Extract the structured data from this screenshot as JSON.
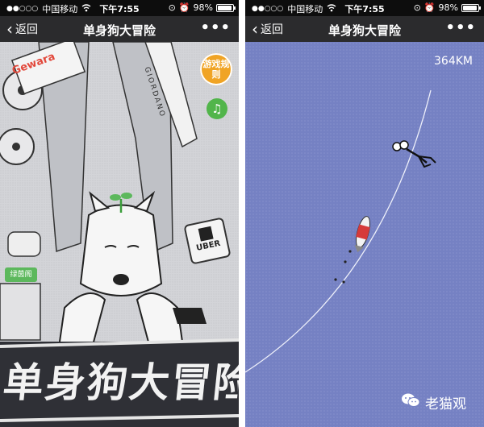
{
  "status_bar": {
    "signal": "●●○○○",
    "carrier": "中国移动",
    "time": "下午7:55",
    "battery": "98%",
    "battery_level": 0.98
  },
  "nav": {
    "back_label": "返回",
    "title": "单身狗大冒险",
    "more": "•••"
  },
  "left_screen": {
    "rules_button": "游戏规则",
    "music_icon": "♫",
    "brand_giordano": "GIORDANO",
    "brand_uber": "UBER",
    "brand_gewara": "Gewara",
    "green_tag": "绿茵阁",
    "banner_title": "单身狗大冒险"
  },
  "right_screen": {
    "distance": "364KM"
  },
  "watermark": {
    "icon": "wechat-icon",
    "text": "老猫观"
  },
  "colors": {
    "nav_bg": "#2b2b2d",
    "status_bg": "#0d0d0d",
    "rules_orange": "#f0a425",
    "music_green": "#52b54b",
    "sky_blue": "#7581c3"
  }
}
